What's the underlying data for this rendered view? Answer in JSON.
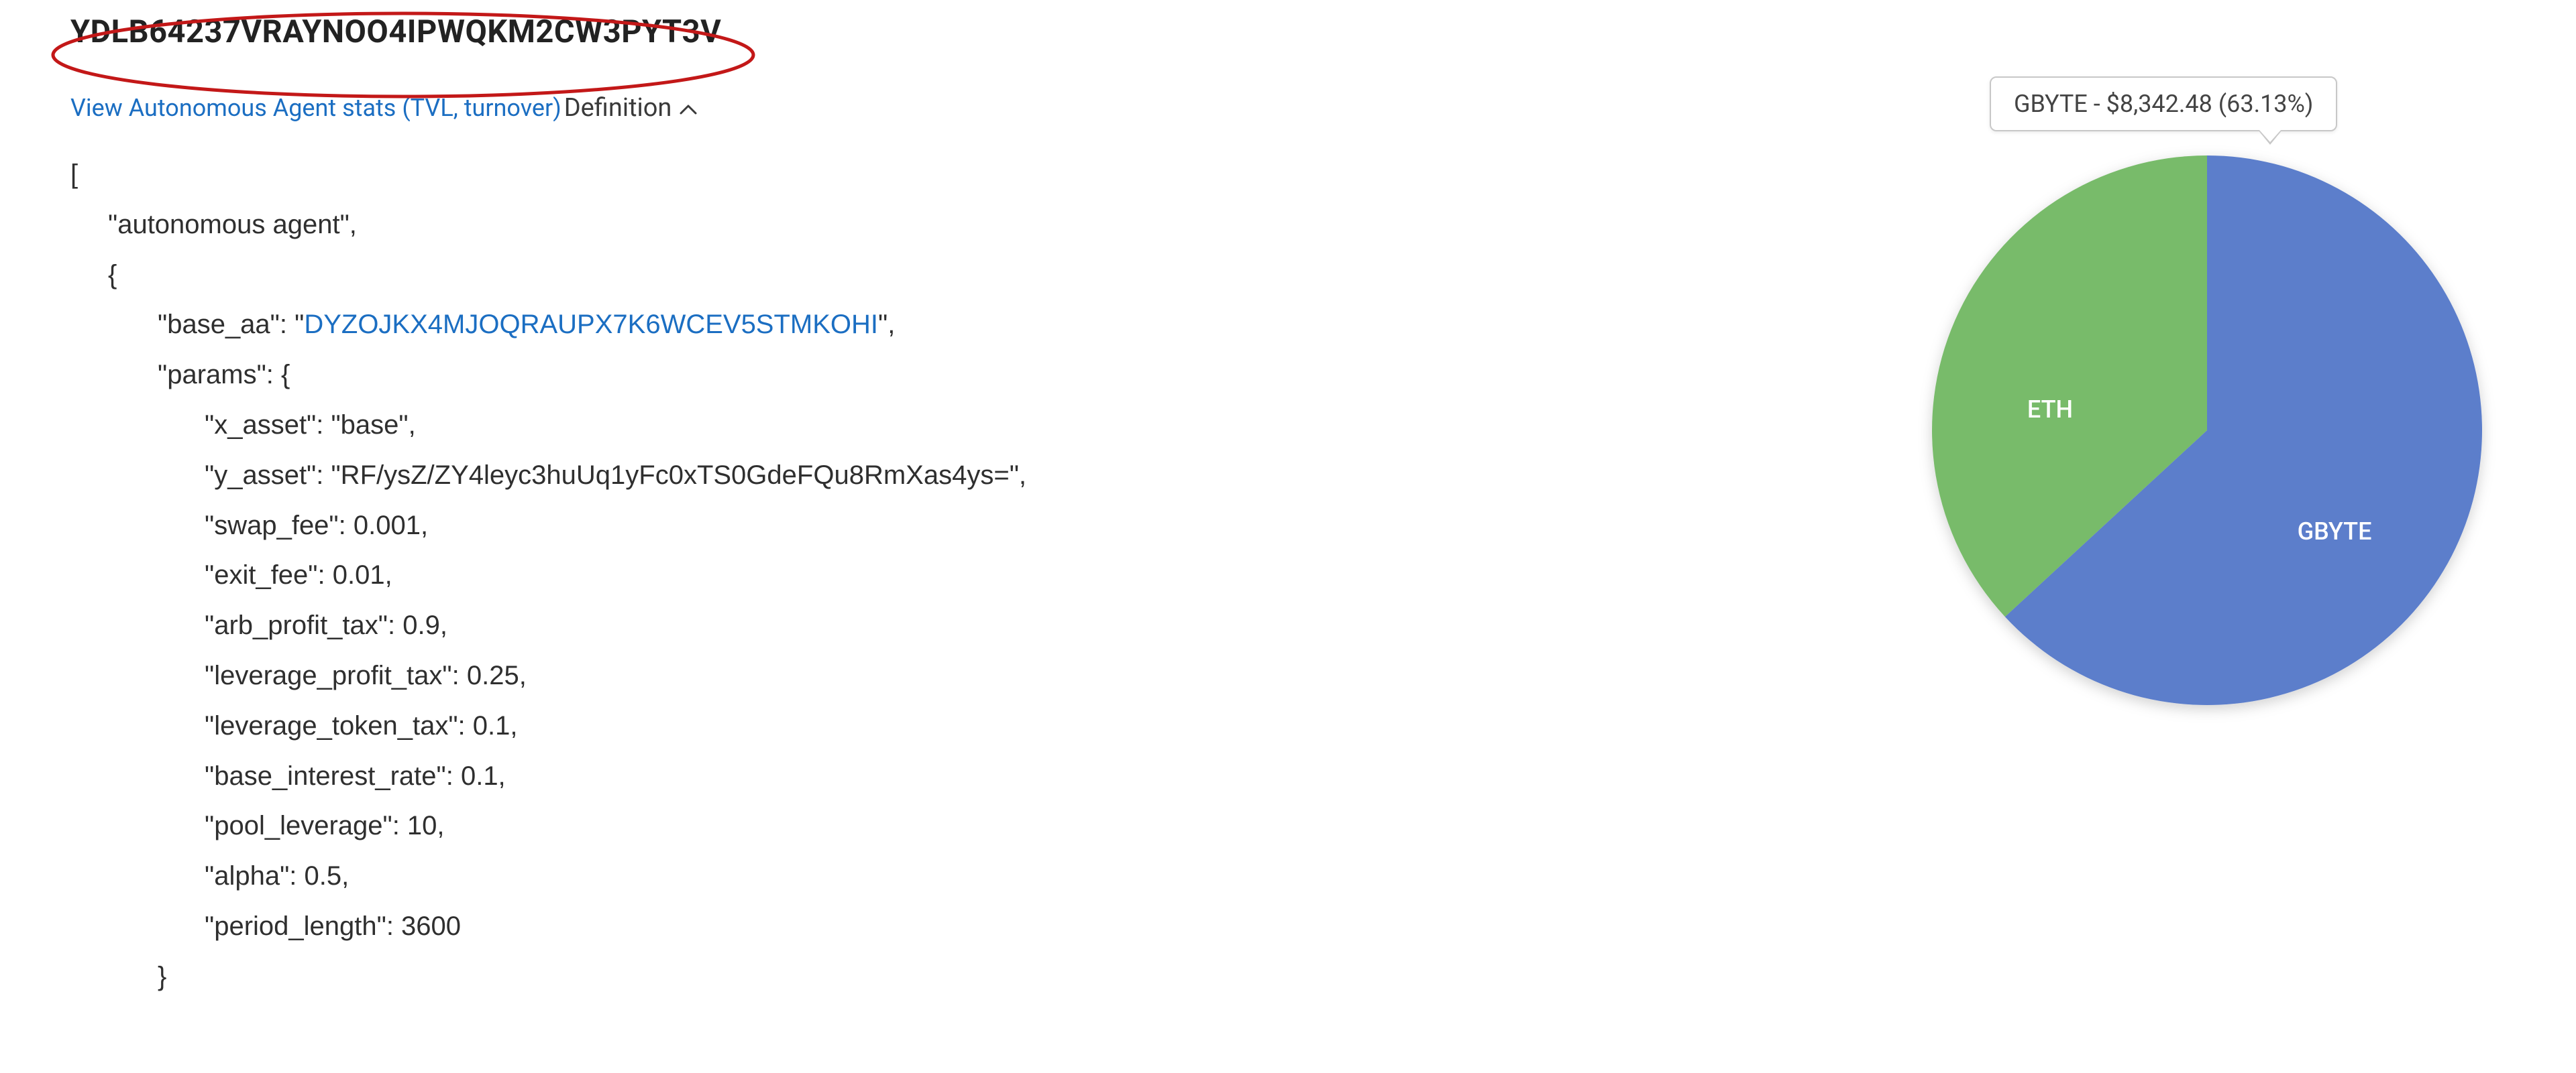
{
  "header": {
    "address": "YDLB64237VRAYNOO4IPWQKM2CW3PYT3V",
    "stats_link_label": "View Autonomous Agent stats (TVL, turnover)"
  },
  "definition": {
    "toggle_label": "Definition",
    "open_bracket": "[",
    "agent_type_line": "\"autonomous agent\",",
    "open_brace": "{",
    "base_aa_key": "\"base_aa\": \"",
    "base_aa_value": "DYZOJKX4MJOQRAUPX7K6WCEV5STMKOHI",
    "base_aa_after": "\",",
    "params_key": "\"params\": {",
    "rows": {
      "x_asset": "\"x_asset\": \"base\",",
      "y_asset": "\"y_asset\": \"RF/ysZ/ZY4leyc3huUq1yFc0xTS0GdeFQu8RmXas4ys=\",",
      "swap_fee": "\"swap_fee\": 0.001,",
      "exit_fee": "\"exit_fee\": 0.01,",
      "arb_profit_tax": "\"arb_profit_tax\": 0.9,",
      "leverage_profit_tax": "\"leverage_profit_tax\": 0.25,",
      "leverage_token_tax": "\"leverage_token_tax\": 0.1,",
      "base_interest_rate": "\"base_interest_rate\": 0.1,",
      "pool_leverage": "\"pool_leverage\": 10,",
      "alpha": "\"alpha\": 0.5,",
      "period_length": "\"period_length\": 3600"
    },
    "close_params": "}"
  },
  "chart": {
    "tooltip": "GBYTE - $8,342.48 (63.13%)",
    "labels": {
      "eth": "ETH",
      "gbyte": "GBYTE"
    },
    "colors": {
      "gbyte": "#5B7ECB",
      "eth": "#78BB6A"
    }
  },
  "chart_data": {
    "type": "pie",
    "title": "",
    "series": [
      {
        "name": "GBYTE",
        "value_usd": 8342.48,
        "percent": 63.13,
        "color": "#5B7ECB"
      },
      {
        "name": "ETH",
        "value_usd": null,
        "percent": 36.87,
        "color": "#78BB6A"
      }
    ],
    "tooltip_active": "GBYTE"
  }
}
